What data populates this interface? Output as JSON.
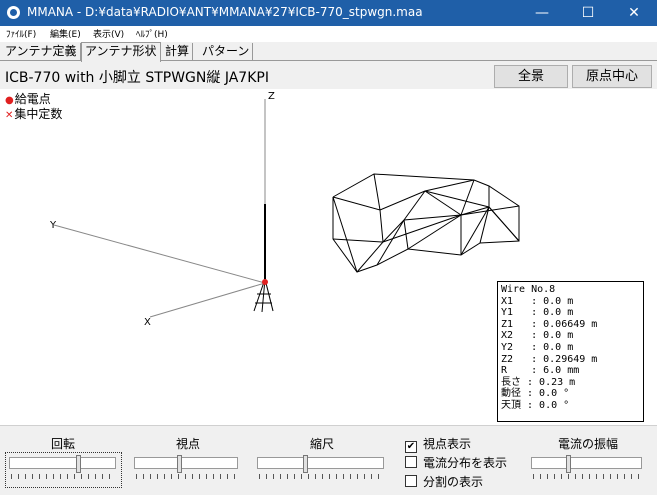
{
  "window": {
    "title": "MMANA - D:¥data¥RADIO¥ANT¥MMANA¥27¥ICB-770_stpwgn.maa",
    "min": "—",
    "max": "☐",
    "close": "✕"
  },
  "menu": [
    "ﾌｧｲﾙ(F)",
    "編集(E)",
    "表示(V)",
    "ﾍﾙﾌﾟ(H)"
  ],
  "tabs": [
    "アンテナ定義",
    "アンテナ形状",
    "計算",
    "パターン"
  ],
  "active_tab": "アンテナ形状",
  "model_name": "ICB-770 with 小脚立 STPWGN縦 JA7KPI",
  "buttons": {
    "full_view": "全景",
    "origin_center": "原点中心"
  },
  "legend": {
    "feed": "給電点",
    "load": "集中定数"
  },
  "axes": {
    "z": "Z",
    "y": "Y",
    "x": "X"
  },
  "wire_info": [
    "Wire No.8",
    "X1   : 0.0 m",
    "Y1   : 0.0 m",
    "Z1   : 0.06649 m",
    "X2   : 0.0 m",
    "Y2   : 0.0 m",
    "Z2   : 0.29649 m",
    "R    : 6.0 mm",
    "長さ : 0.23 m",
    "動径 : 0.0 °",
    "天頂 : 0.0 °"
  ],
  "controls": {
    "rotate": "回転",
    "viewpoint": "視点",
    "scale": "縮尺",
    "current_amplitude": "電流の振幅"
  },
  "checkboxes": {
    "show_viewpoint": {
      "label": "視点表示",
      "checked": true,
      "mark": "✔"
    },
    "show_current": {
      "label": "電流分布を表示",
      "checked": false,
      "mark": ""
    },
    "show_segments": {
      "label": "分割の表示",
      "checked": false,
      "mark": ""
    }
  },
  "colors": {
    "titlebar": "#1f5fa8",
    "feed_marker": "#e02020"
  }
}
